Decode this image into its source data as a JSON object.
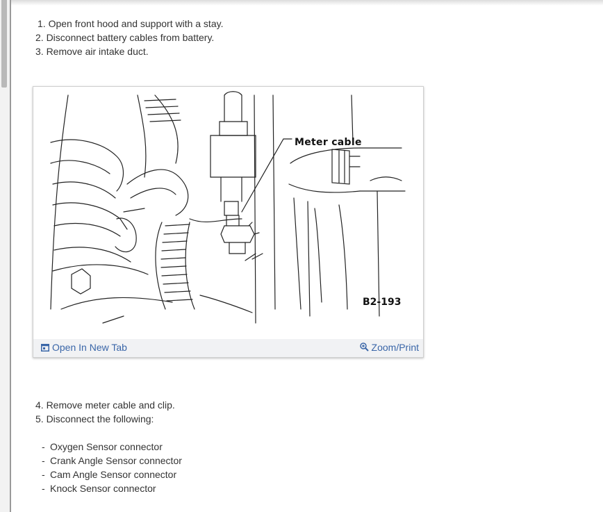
{
  "steps_before": [
    "1. Open front hood and support with a stay.",
    "2. Disconnect battery cables from battery.",
    "3. Remove air intake duct."
  ],
  "figure": {
    "callout_label": "Meter cable",
    "figure_code": "B2-193",
    "open_in_new_tab_label": "Open In New Tab",
    "zoom_print_label": "Zoom/Print",
    "link_color": "#3a66a8"
  },
  "steps_after": [
    "4. Remove meter cable and clip.",
    "5. Disconnect the following:"
  ],
  "connectors": [
    "Oxygen Sensor connector",
    "Crank Angle Sensor connector",
    "Cam Angle Sensor connector",
    "Knock Sensor connector"
  ],
  "bullet_marker": "-"
}
